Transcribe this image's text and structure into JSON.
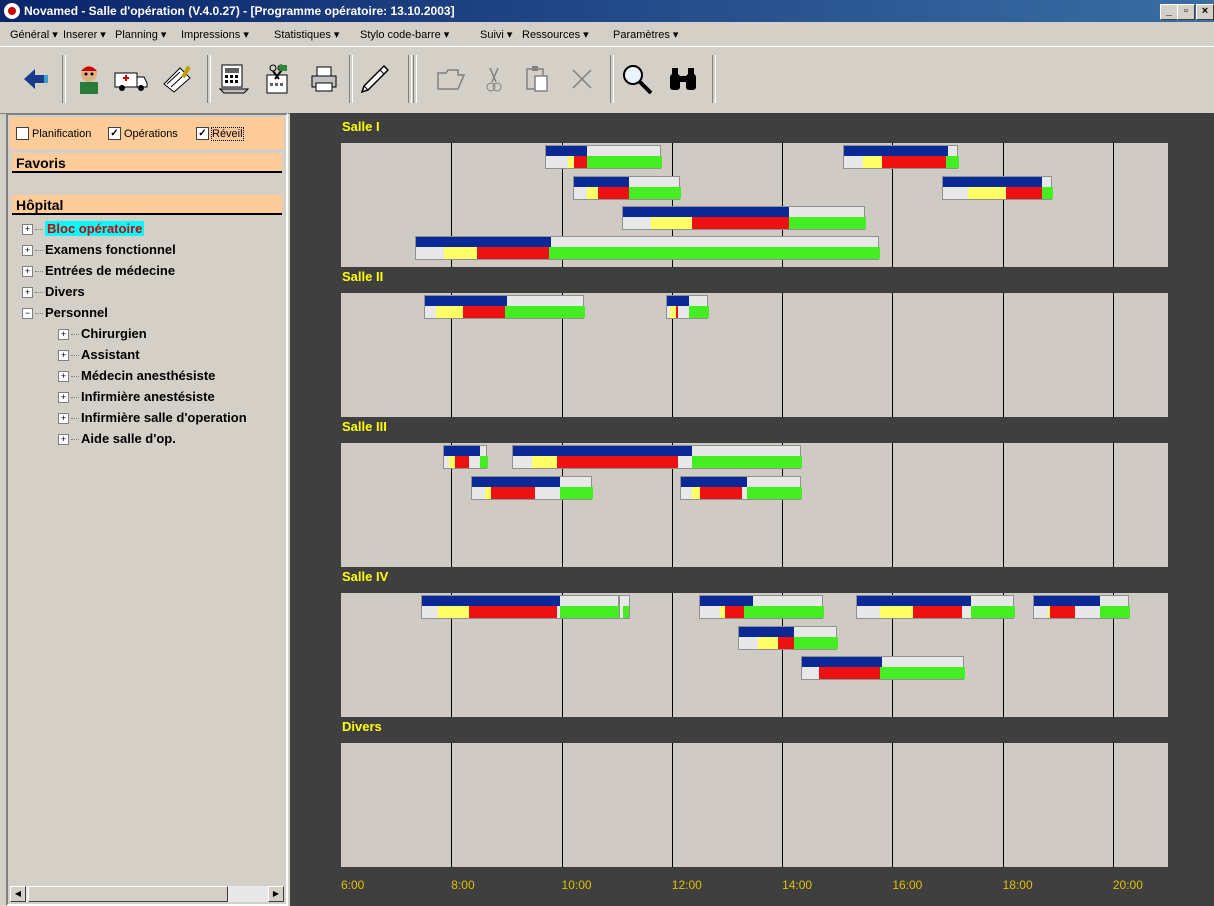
{
  "window": {
    "title": "Novamed - Salle d'opération (V.4.0.27) - [Programme opératoire: 13.10.2003]",
    "controls": [
      "_",
      "▫",
      "×"
    ]
  },
  "menu": [
    "Général",
    "Inserer",
    "Planning",
    "Impressions",
    "Statistiques",
    "Stylo code-barre",
    "Suivi",
    "Ressources",
    "Paramètres"
  ],
  "toolbar_icons": [
    "back-icon",
    "patient-icon",
    "ambulance-icon",
    "clipboard-icon",
    "calculator-icon",
    "tools-icon",
    "printer-icon",
    "pen-icon",
    "open-folder-icon",
    "scissors-icon",
    "paste-icon",
    "delete-icon",
    "search-icon",
    "binoculars-icon"
  ],
  "filters": {
    "planification": {
      "label": "Planification",
      "checked": false
    },
    "operations": {
      "label": "Opérations",
      "checked": true
    },
    "reveil": {
      "label": "Réveil",
      "checked": true
    }
  },
  "sidebar": {
    "favoris": "Favoris",
    "hopital": "Hôpital",
    "tree": [
      {
        "label": "Bloc opératoire",
        "level": 0,
        "expanded": false,
        "selected": true
      },
      {
        "label": "Examens fonctionnel",
        "level": 0,
        "expanded": false
      },
      {
        "label": "Entrées de médecine",
        "level": 0,
        "expanded": false
      },
      {
        "label": "Divers",
        "level": 0,
        "expanded": false
      },
      {
        "label": "Personnel",
        "level": 0,
        "expanded": true
      },
      {
        "label": "Chirurgien",
        "level": 1,
        "expanded": false
      },
      {
        "label": "Assistant",
        "level": 1,
        "expanded": false
      },
      {
        "label": "Médecin anesthésiste",
        "level": 1,
        "expanded": false
      },
      {
        "label": "Infirmière anestésiste",
        "level": 1,
        "expanded": false
      },
      {
        "label": "Infirmière salle d'operation",
        "level": 1,
        "expanded": false
      },
      {
        "label": "Aide salle d'op.",
        "level": 1,
        "expanded": false
      }
    ]
  },
  "colors": {
    "planned": "#0a2896",
    "preparation": "#ffff66",
    "operation": "#ee1111",
    "recovery": "#44ee22",
    "room_label": "#ffff00",
    "time_label": "#e0c000"
  },
  "schedule": {
    "time_start": 6,
    "time_end": 21,
    "time_labels": [
      "6:00",
      "8:00",
      "10:00",
      "12:00",
      "14:00",
      "16:00",
      "18:00",
      "20:00"
    ],
    "rooms": [
      {
        "name": "Salle I",
        "operations": [
          {
            "row": 0,
            "start": 9.7,
            "end": 11.8,
            "blue": [
              9.7,
              10.45
            ],
            "yellow": [
              10.1,
              10.2
            ],
            "red": [
              10.2,
              10.45
            ],
            "green": [
              10.45,
              11.8
            ]
          },
          {
            "row": 0,
            "start": 15.1,
            "end": 17.2,
            "blue": [
              15.1,
              17.0
            ],
            "yellow": [
              15.45,
              15.8
            ],
            "red": [
              15.8,
              16.95
            ],
            "green": [
              16.95,
              17.2
            ]
          },
          {
            "row": 1,
            "start": 10.2,
            "end": 12.15,
            "blue": [
              10.2,
              11.2
            ],
            "yellow": [
              10.45,
              10.65
            ],
            "red": [
              10.65,
              11.2
            ],
            "green": [
              11.2,
              12.15
            ]
          },
          {
            "row": 1,
            "start": 16.9,
            "end": 18.9,
            "blue": [
              16.9,
              18.7
            ],
            "yellow": [
              17.35,
              18.05
            ],
            "red": [
              18.05,
              18.7
            ],
            "green": [
              18.7,
              18.9
            ]
          },
          {
            "row": 2,
            "start": 11.1,
            "end": 15.5,
            "blue": [
              11.1,
              14.1
            ],
            "yellow": [
              11.6,
              12.35
            ],
            "red": [
              12.35,
              14.1
            ],
            "green": [
              14.1,
              15.5
            ]
          },
          {
            "row": 3,
            "start": 7.35,
            "end": 15.75,
            "blue": [
              7.35,
              9.8
            ],
            "yellow": [
              7.85,
              8.45
            ],
            "red": [
              8.45,
              9.75
            ],
            "green": [
              9.75,
              15.75
            ]
          }
        ]
      },
      {
        "name": "Salle II",
        "operations": [
          {
            "row": 0,
            "start": 7.5,
            "end": 10.4,
            "blue": [
              7.5,
              9.0
            ],
            "yellow": [
              7.7,
              8.2
            ],
            "red": [
              8.2,
              8.95
            ],
            "green": [
              8.95,
              10.4
            ]
          },
          {
            "row": 0,
            "start": 11.9,
            "end": 12.65,
            "blue": [
              11.9,
              12.3
            ],
            "yellow": [
              11.95,
              12.05
            ],
            "red": [
              12.05,
              12.1
            ],
            "green": [
              12.3,
              12.65
            ]
          }
        ]
      },
      {
        "name": "Salle III",
        "operations": [
          {
            "row": 0,
            "start": 7.85,
            "end": 8.65,
            "blue": [
              7.85,
              8.5
            ],
            "yellow": [
              7.95,
              8.05
            ],
            "red": [
              8.05,
              8.3
            ],
            "green": [
              8.5,
              8.65
            ]
          },
          {
            "row": 0,
            "start": 9.1,
            "end": 14.35,
            "blue": [
              9.1,
              12.35
            ],
            "yellow": [
              9.45,
              9.9
            ],
            "red": [
              9.9,
              12.1
            ],
            "green": [
              12.35,
              14.35
            ]
          },
          {
            "row": 1,
            "start": 8.35,
            "end": 10.55,
            "blue": [
              8.35,
              9.95
            ],
            "yellow": [
              8.6,
              8.7
            ],
            "red": [
              8.7,
              9.5
            ],
            "green": [
              9.95,
              10.55
            ]
          },
          {
            "row": 1,
            "start": 12.15,
            "end": 14.35,
            "blue": [
              12.15,
              13.35
            ],
            "yellow": [
              12.35,
              12.5
            ],
            "red": [
              12.5,
              13.25
            ],
            "green": [
              13.35,
              14.35
            ]
          }
        ]
      },
      {
        "name": "Salle IV",
        "operations": [
          {
            "row": 0,
            "start": 7.45,
            "end": 11.05,
            "blue": [
              7.45,
              9.95
            ],
            "yellow": [
              7.75,
              8.3
            ],
            "red": [
              8.3,
              9.9
            ],
            "green": [
              9.95,
              11.05
            ]
          },
          {
            "row": 0,
            "start": 11.05,
            "end": 11.25,
            "blue": [
              11.05,
              11.05
            ],
            "yellow": [
              11.05,
              11.05
            ],
            "red": [
              11.05,
              11.05
            ],
            "green": [
              11.1,
              11.2
            ]
          },
          {
            "row": 0,
            "start": 12.5,
            "end": 14.75,
            "blue": [
              12.5,
              13.45
            ],
            "yellow": [
              12.85,
              12.95
            ],
            "red": [
              12.95,
              13.3
            ],
            "green": [
              13.3,
              14.75
            ]
          },
          {
            "row": 0,
            "start": 15.35,
            "end": 18.2,
            "blue": [
              15.35,
              17.4
            ],
            "yellow": [
              15.75,
              16.35
            ],
            "red": [
              16.35,
              17.25
            ],
            "green": [
              17.4,
              18.2
            ]
          },
          {
            "row": 0,
            "start": 18.55,
            "end": 20.3,
            "blue": [
              18.55,
              19.75
            ],
            "yellow": [
              18.8,
              18.85
            ],
            "red": [
              18.85,
              19.3
            ],
            "green": [
              19.75,
              20.3
            ]
          },
          {
            "row": 1,
            "start": 13.2,
            "end": 15.0,
            "blue": [
              13.2,
              14.2
            ],
            "yellow": [
              13.55,
              13.9
            ],
            "red": [
              13.9,
              14.2
            ],
            "green": [
              14.2,
              15.0
            ]
          },
          {
            "row": 2,
            "start": 14.35,
            "end": 17.3,
            "blue": [
              14.35,
              15.8
            ],
            "yellow": [
              14.65,
              14.65
            ],
            "red": [
              14.65,
              15.75
            ],
            "green": [
              15.75,
              17.3
            ]
          }
        ]
      },
      {
        "name": "Divers",
        "operations": []
      }
    ]
  }
}
